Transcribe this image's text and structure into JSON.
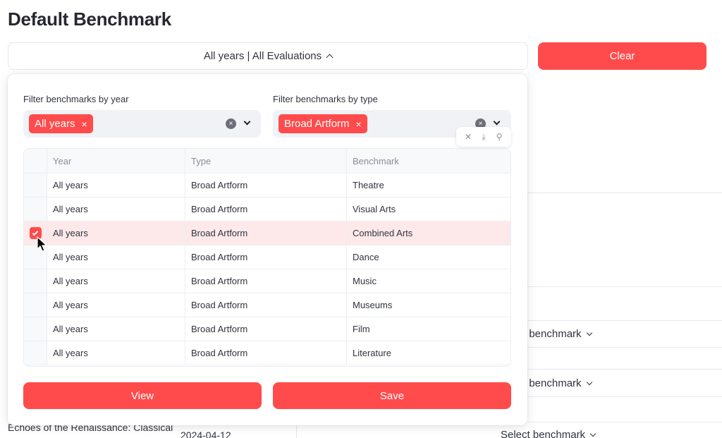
{
  "page": {
    "title": "Default Benchmark"
  },
  "expander": {
    "summary": "All years | All Evaluations",
    "icon": "chevron-up-icon"
  },
  "clear_button": {
    "label": "Clear"
  },
  "filters": {
    "year": {
      "label": "Filter benchmarks by year",
      "selected": [
        "All years"
      ]
    },
    "type": {
      "label": "Filter benchmarks by type",
      "selected": [
        "Broad Artform"
      ]
    },
    "tag_remove_glyph": "×",
    "clear_glyph": "×"
  },
  "table_toolbar": {
    "close": "✕",
    "download": "⤓",
    "search": "⚲"
  },
  "table": {
    "columns": [
      "Year",
      "Type",
      "Benchmark"
    ],
    "rows": [
      {
        "year": "All years",
        "type": "Broad Artform",
        "benchmark": "Theatre",
        "selected": false
      },
      {
        "year": "All years",
        "type": "Broad Artform",
        "benchmark": "Visual Arts",
        "selected": false
      },
      {
        "year": "All years",
        "type": "Broad Artform",
        "benchmark": "Combined Arts",
        "selected": true
      },
      {
        "year": "All years",
        "type": "Broad Artform",
        "benchmark": "Dance",
        "selected": false
      },
      {
        "year": "All years",
        "type": "Broad Artform",
        "benchmark": "Music",
        "selected": false
      },
      {
        "year": "All years",
        "type": "Broad Artform",
        "benchmark": "Museums",
        "selected": false
      },
      {
        "year": "All years",
        "type": "Broad Artform",
        "benchmark": "Film",
        "selected": false
      },
      {
        "year": "All years",
        "type": "Broad Artform",
        "benchmark": "Literature",
        "selected": false
      }
    ]
  },
  "actions": {
    "view_label": "View",
    "save_label": "Save"
  },
  "background": {
    "select_partial_1": "t benchmark",
    "select_partial_2": "t benchmark",
    "select_full": "Select benchmark",
    "event_title": "Echoes of the Renaissance: Classical",
    "event_date": "2024-04-12"
  },
  "colors": {
    "accent": "#ff4b4b",
    "selected_row": "#fde9ea",
    "input_bg": "#f0f2f6"
  }
}
